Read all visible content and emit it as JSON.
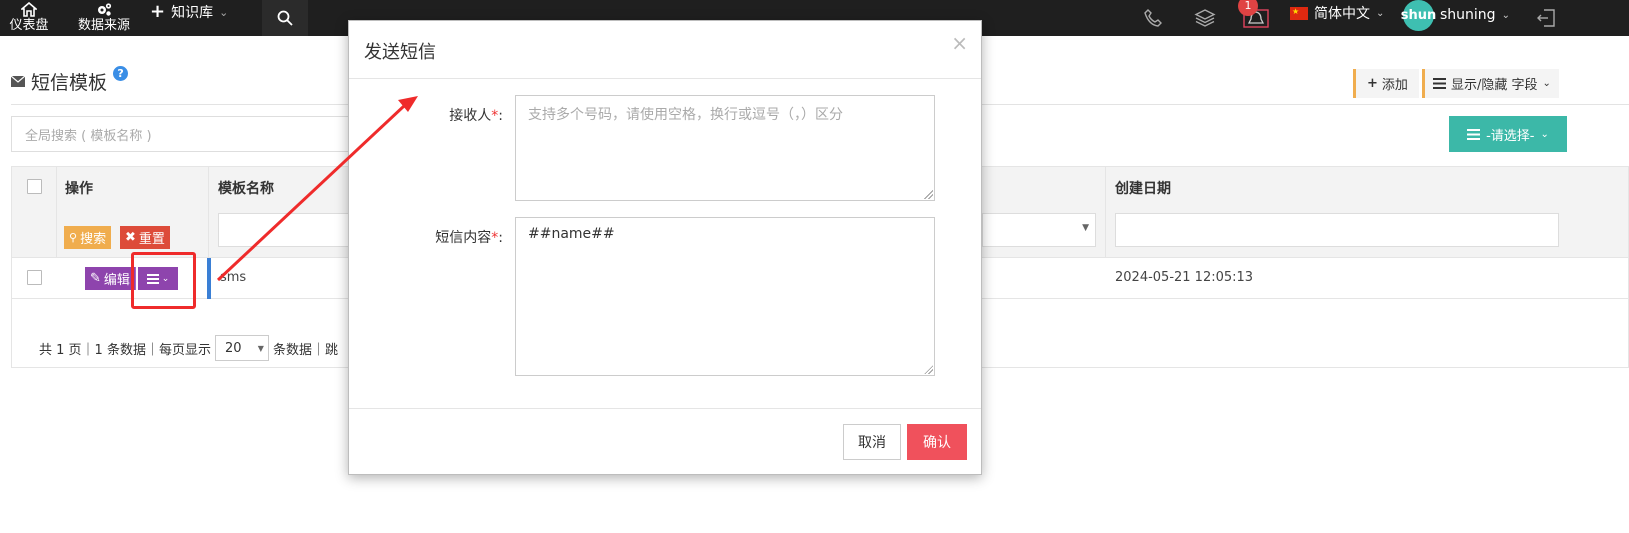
{
  "topbar": {
    "dashboard_label": "仪表盘",
    "datasource_label": "数据来源",
    "knowledge_label": "知识库",
    "notification_count": "1",
    "language_label": "简体中文",
    "avatar_text": "shun",
    "username": "shuning"
  },
  "page": {
    "title": "短信模板",
    "add_label": "添加",
    "columns_label": "显示/隐藏 字段",
    "search_placeholder": "全局搜索 ( 模板名称 )",
    "select_label": "-请选择-"
  },
  "table": {
    "headers": {
      "action": "操作",
      "name": "模板名称",
      "created": "创建日期"
    },
    "search_btn": "搜索",
    "reset_btn": "重置",
    "rows": [
      {
        "edit_label": "编辑",
        "name": "sms",
        "created": "2024-05-21 12:05:13"
      }
    ],
    "pager": {
      "pages_text": "共 1 页｜1 条数据｜每页显示",
      "page_size": "20",
      "suffix_text": "条数据｜跳"
    }
  },
  "modal": {
    "title": "发送短信",
    "recipient_label": "接收人",
    "recipient_placeholder": "支持多个号码，请使用空格，换行或逗号（，）区分",
    "content_label": "短信内容",
    "content_value": "##name##",
    "required_mark": "*",
    "colon": ":",
    "cancel_label": "取消",
    "confirm_label": "确认"
  },
  "colors": {
    "topbar": "#1f1f1f",
    "teal": "#3cb8a8",
    "purple": "#8e44ad",
    "orange": "#f0ad4e",
    "red": "#dd4b39",
    "confirm": "#f0515c",
    "annotation": "#ef2b2b"
  }
}
